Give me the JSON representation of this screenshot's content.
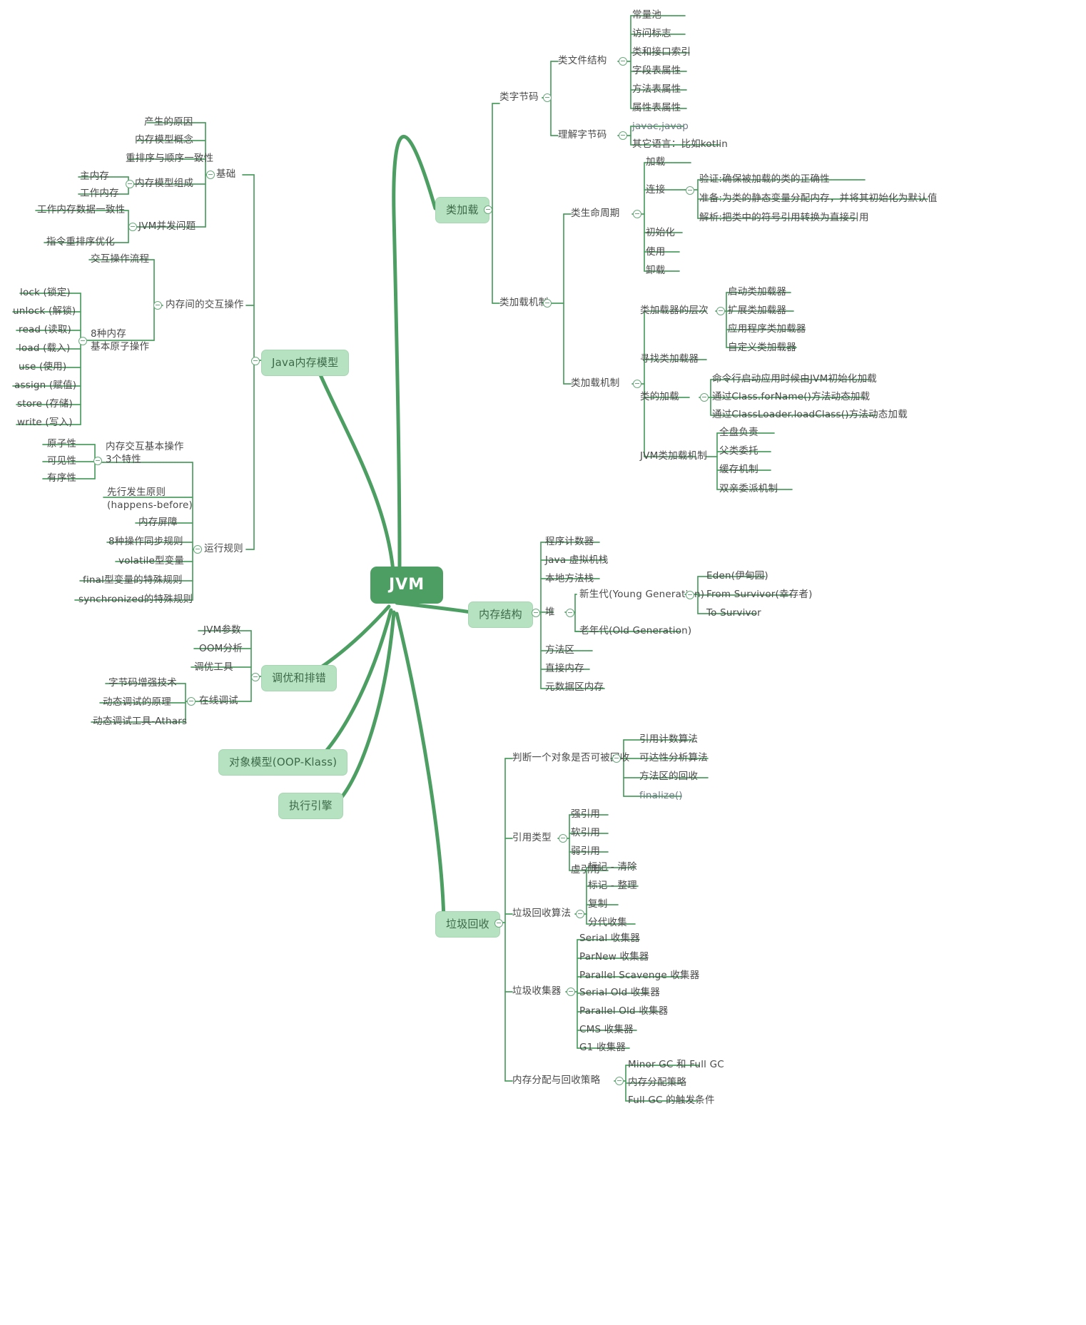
{
  "diagram": {
    "type": "mindmap",
    "title": "JVM",
    "accent_color": "#4d9e62",
    "branch_fill": "#b7e2c1",
    "line_color": "#4d9e62",
    "text_color": "#4a4a4a"
  },
  "root": {
    "label": "JVM"
  },
  "branches": {
    "class_loading": {
      "label": "类加载"
    },
    "memory_model": {
      "label": "Java内存模型"
    },
    "memory_structure": {
      "label": "内存结构"
    },
    "tuning": {
      "label": "调优和排错"
    },
    "object_model": {
      "label": "对象模型(OOP-Klass)"
    },
    "exec_engine": {
      "label": "执行引擎"
    },
    "gc": {
      "label": "垃圾回收"
    }
  },
  "class_loading": {
    "bytecode": {
      "label": "类字节码"
    },
    "class_file_structure": {
      "label": "类文件结构"
    },
    "class_file_items": [
      "常量池",
      "访问标志",
      "类和接口索引",
      "字段表属性",
      "方法表属性",
      "属性表属性"
    ],
    "understand_bytecode": {
      "label": "理解字节码"
    },
    "understand_items": [
      "javac,javap",
      "其它语言：比如kotlin"
    ],
    "mechanism": {
      "label": "类加载机制"
    },
    "lifecycle": {
      "label": "类生命周期"
    },
    "lifecycle_items": [
      "加载",
      "连接",
      "初始化",
      "使用",
      "卸载"
    ],
    "link_items": [
      "验证:确保被加载的类的正确性",
      "准备:为类的静态变量分配内存，并将其初始化为默认值",
      "解析:把类中的符号引用转换为直接引用"
    ],
    "loader_mechanism": {
      "label": "类加载机制"
    },
    "loader_levels": {
      "label": "类加载器的层次"
    },
    "loader_levels_items": [
      "启动类加载器",
      "扩展类加载器",
      "应用程序类加载器",
      "自定义类加载器"
    ],
    "find_loader": {
      "label": "寻找类加载器"
    },
    "class_load": {
      "label": "类的加载"
    },
    "class_load_items": [
      "命令行启动应用时候由JVM初始化加载",
      "通过Class.forName()方法动态加载",
      "通过ClassLoader.loadClass()方法动态加载"
    ],
    "jvm_loader_mechanism": {
      "label": "JVM类加载机制"
    },
    "jvm_loader_items": [
      "全盘负责",
      "父类委托",
      "缓存机制",
      "双亲委派机制"
    ]
  },
  "memory_model": {
    "basics": {
      "label": "基础"
    },
    "basics_items": [
      "产生的原因",
      "内存模型概念",
      "重排序与顺序一致性"
    ],
    "model_composition": {
      "label": "内存模型组成"
    },
    "model_composition_items": [
      "主内存",
      "工作内存"
    ],
    "concurrency": {
      "label": "JVM并发问题"
    },
    "concurrency_items": [
      "工作内存数据一致性",
      "指令重排序优化"
    ],
    "interaction": {
      "label": "内存间的交互操作"
    },
    "interaction_flow": {
      "label": "交互操作流程"
    },
    "atomic_ops": {
      "label": "8种内存\n基本原子操作"
    },
    "atomic_ops_items": [
      "lock (锁定)",
      "unlock (解锁)",
      "read (读取)",
      "load (载入)",
      "use (使用)",
      "assign (赋值)",
      "store (存储)",
      "write (写入)"
    ],
    "three_features": {
      "label": "内存交互基本操作\n3个特性"
    },
    "three_features_items": [
      "原子性",
      "可见性",
      "有序性"
    ],
    "rules": {
      "label": "运行规则"
    },
    "rules_items": [
      "先行发生原则\n(happens-before)",
      "内存屏障",
      "8种操作同步规则",
      "volatile型变量",
      "final型变量的特殊规则",
      "synchronized的特殊规则"
    ]
  },
  "memory_structure": {
    "items": [
      "程序计数器",
      "Java 虚拟机栈",
      "本地方法栈"
    ],
    "heap": {
      "label": "堆"
    },
    "young": {
      "label": "新生代(Young Generation)"
    },
    "young_items": [
      "Eden(伊甸园)",
      "From Survivor(幸存者)",
      "To Survivor"
    ],
    "old": {
      "label": "老年代(Old Generation)"
    },
    "tail_items": [
      "方法区",
      "直接内存",
      "元数据区内存"
    ]
  },
  "tuning": {
    "items": [
      "JVM参数",
      "OOM分析",
      "调优工具"
    ],
    "online_debug": {
      "label": "在线调试"
    },
    "online_debug_items": [
      "字节码增强技术",
      "动态调试的原理",
      "动态调试工具-Athars"
    ]
  },
  "gc": {
    "judge": {
      "label": "判断一个对象是否可被回收"
    },
    "judge_items": [
      "引用计数算法",
      "可达性分析算法",
      "方法区的回收",
      "finalize()"
    ],
    "ref_types": {
      "label": "引用类型"
    },
    "ref_types_items": [
      "强引用",
      "软引用",
      "弱引用",
      "虚引用"
    ],
    "algorithms": {
      "label": "垃圾回收算法"
    },
    "algorithms_items": [
      "标记 - 清除",
      "标记 - 整理",
      "复制",
      "分代收集"
    ],
    "collectors": {
      "label": "垃圾收集器"
    },
    "collectors_items": [
      "Serial 收集器",
      "ParNew 收集器",
      "Parallel Scavenge 收集器",
      "Serial Old 收集器",
      "Parallel Old 收集器",
      "CMS 收集器",
      "G1 收集器"
    ],
    "allocation": {
      "label": "内存分配与回收策略"
    },
    "allocation_items": [
      "Minor GC 和 Full GC",
      "内存分配策略",
      "Full GC 的触发条件"
    ]
  }
}
